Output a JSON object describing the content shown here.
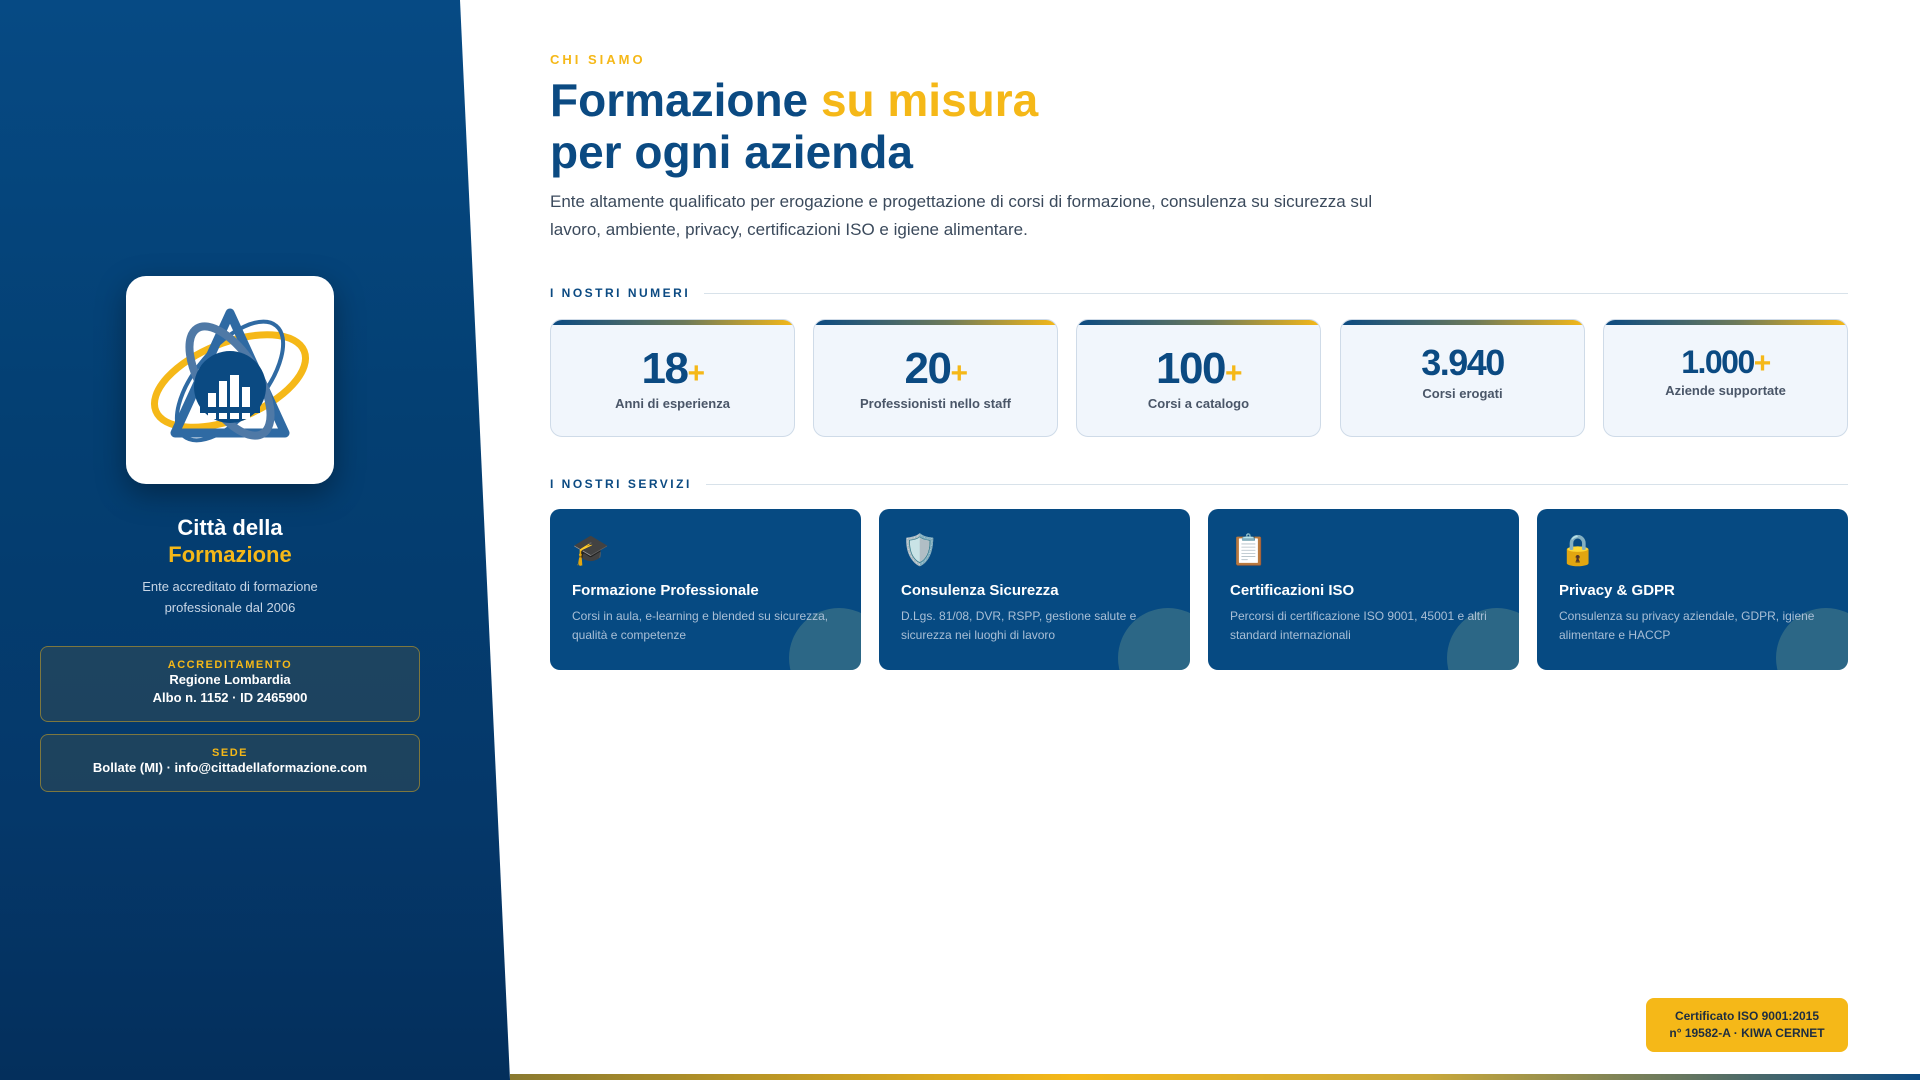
{
  "sidebar": {
    "brand_line1": "Città della",
    "brand_line2": "Formazione",
    "subtitle": "Ente accreditato di formazione professionale dal 2006",
    "accreditation": {
      "label": "ACCREDITAMENTO",
      "line1": "Regione Lombardia",
      "line2": "Albo n. 1152 · ID 2465900"
    },
    "office": {
      "label": "SEDE",
      "line1": "Bollate (MI) · info@cittadellaformazione.com"
    }
  },
  "main": {
    "eyebrow": "CHI SIAMO",
    "headline_part1": "Formazione ",
    "headline_accent": "su misura",
    "headline_line2": "per ogni azienda",
    "intro": "Ente altamente qualificato per erogazione e progettazione di corsi di formazione, consulenza su sicurezza sul lavoro, ambiente, privacy, certificazioni ISO e igiene alimentare."
  },
  "numbers": {
    "section_title": "I NOSTRI NUMERI",
    "items": [
      {
        "value": "18",
        "suffix": "+",
        "label": "Anni di esperienza"
      },
      {
        "value": "20",
        "suffix": "+",
        "label": "Professionisti nello staff"
      },
      {
        "value": "100",
        "suffix": "+",
        "label": "Corsi a catalogo"
      },
      {
        "value": "3.940",
        "suffix": "",
        "label": "Corsi erogati"
      },
      {
        "value": "1.000",
        "suffix": "+",
        "label": "Aziende supportate"
      }
    ]
  },
  "services": {
    "section_title": "I NOSTRI SERVIZI",
    "items": [
      {
        "icon": "🎓",
        "icon_name": "graduation-cap-icon",
        "title": "Formazione Professionale",
        "desc": "Corsi in aula, e-learning e blended su sicurezza, qualità e competenze"
      },
      {
        "icon": "🛡️",
        "icon_name": "shield-icon",
        "title": "Consulenza Sicurezza",
        "desc": "D.Lgs. 81/08, DVR, RSPP, gestione salute e sicurezza nei luoghi di lavoro"
      },
      {
        "icon": "📋",
        "icon_name": "clipboard-icon",
        "title": "Certificazioni ISO",
        "desc": "Percorsi di certificazione ISO 9001, 45001 e altri standard internazionali"
      },
      {
        "icon": "🔒",
        "icon_name": "lock-icon",
        "title": "Privacy & GDPR",
        "desc": "Consulenza su privacy aziendale, GDPR, igiene alimentare e HACCP"
      }
    ]
  },
  "badge": {
    "line1": "Certificato ISO 9001:2015",
    "line2": "n° 19582-A · KIWA CERNET"
  },
  "colors": {
    "primary": "#0b4a82",
    "accent": "#f5b818",
    "panel": "#064a84"
  }
}
